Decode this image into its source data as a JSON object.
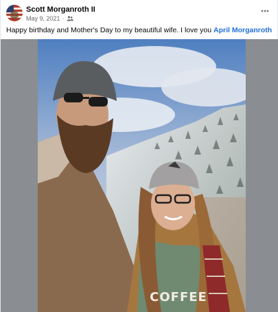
{
  "post": {
    "author": "Scott Morganroth II",
    "date": "May 9, 2021",
    "separator": "·",
    "audience_icon": "friends-icon",
    "more_icon": "more-options-icon",
    "caption_text": "Happy birthday and Mother's Day to my beautiful wife. I love you ",
    "mention": "April Morganroth",
    "cap_text": "COFFEE"
  },
  "colors": {
    "mention": "#216fdb",
    "meta": "#65676b",
    "media_bg": "#8a8d91"
  }
}
